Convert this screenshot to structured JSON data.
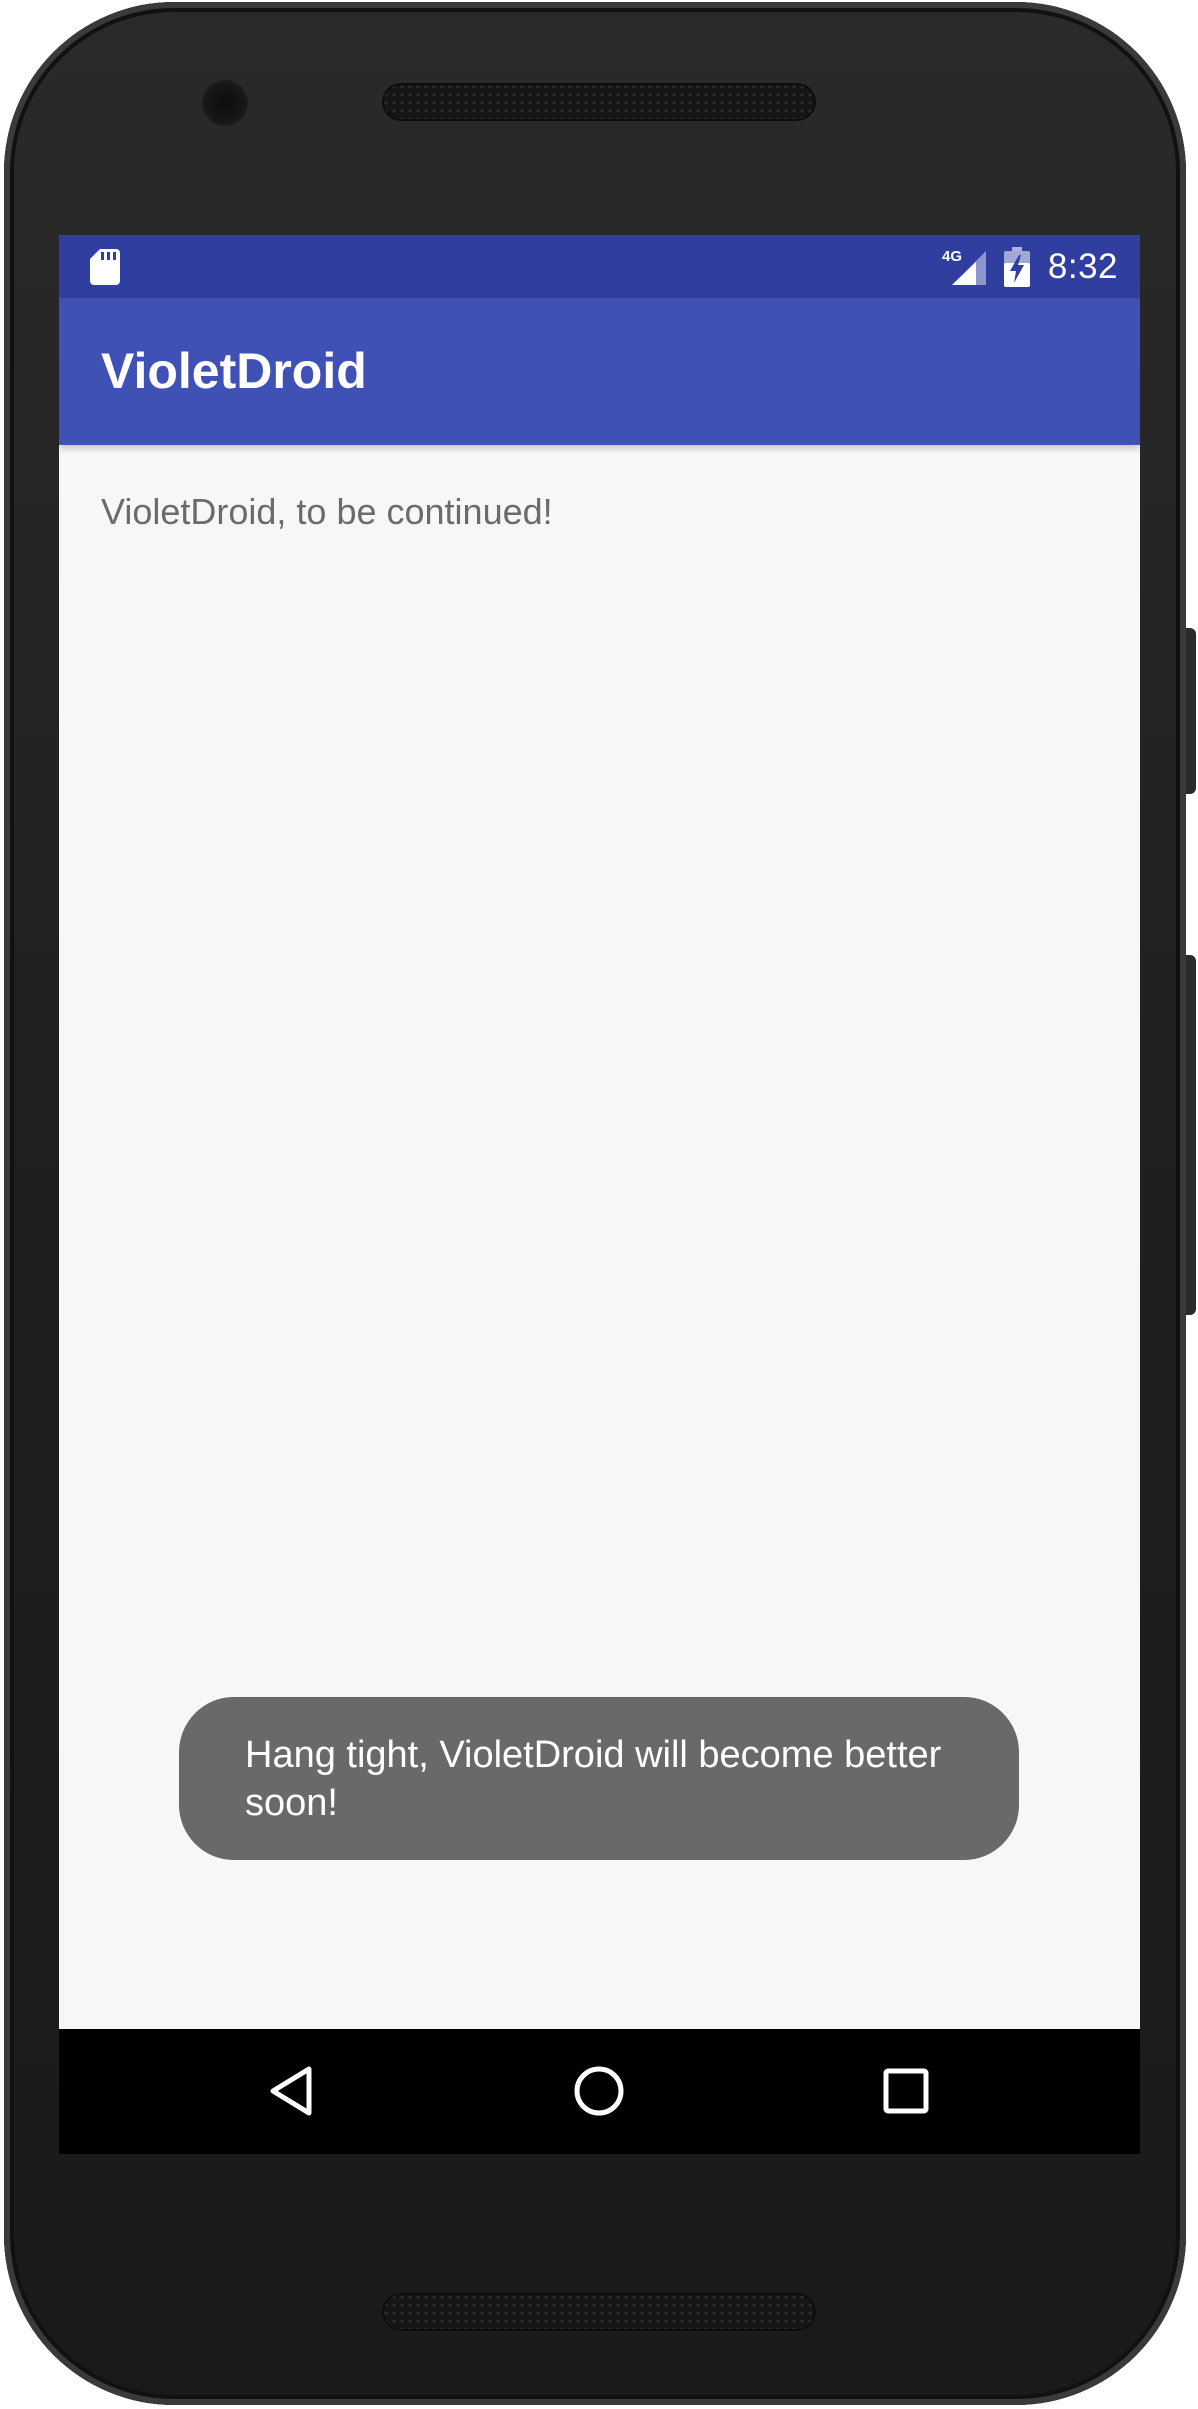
{
  "device": {
    "frame_color": "#1f1f1f"
  },
  "status_bar": {
    "time": "8:32",
    "network_label": "4G",
    "color": "#303f9f",
    "icons": [
      "sd-card-icon",
      "signal-4g-icon",
      "battery-charging-icon"
    ]
  },
  "app_bar": {
    "title": "VioletDroid",
    "color": "#3f51b5"
  },
  "main": {
    "message": "VioletDroid, to be continued!",
    "background": "#f7f7f7"
  },
  "toast": {
    "line1": "Hang tight, VioletDroid will become better",
    "line2": "soon!",
    "color": "#696969"
  },
  "nav_bar": {
    "buttons": [
      "back-icon",
      "home-icon",
      "recents-icon"
    ],
    "color": "#000000"
  }
}
